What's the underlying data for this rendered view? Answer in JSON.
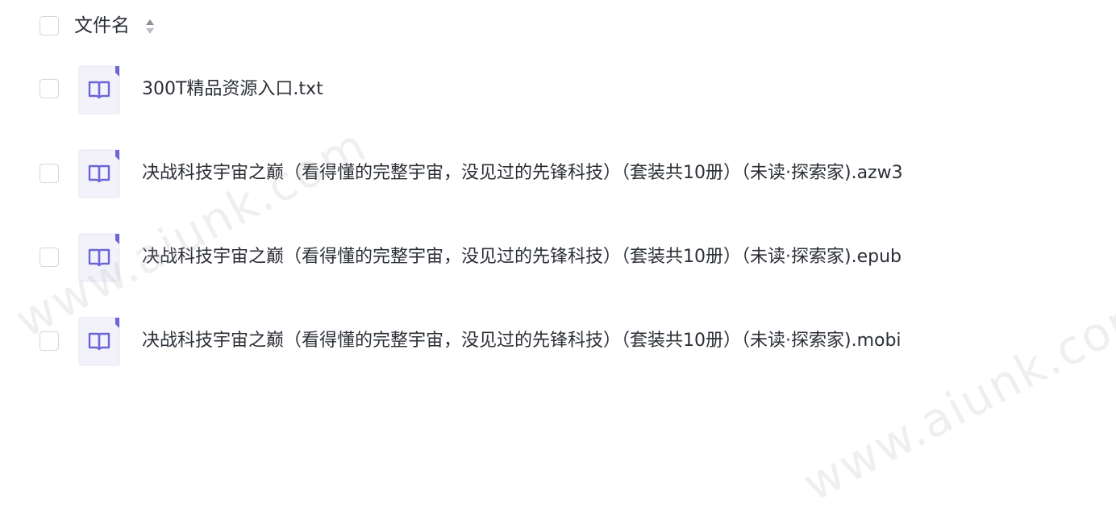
{
  "header": {
    "column_label": "文件名"
  },
  "files": [
    {
      "name": "300T精品资源入口.txt"
    },
    {
      "name": "决战科技宇宙之巅（看得懂的完整宇宙，没见过的先锋科技）（套装共10册）（未读·探索家).azw3"
    },
    {
      "name": "决战科技宇宙之巅（看得懂的完整宇宙，没见过的先锋科技）（套装共10册）（未读·探索家).epub"
    },
    {
      "name": "决战科技宇宙之巅（看得懂的完整宇宙，没见过的先锋科技）（套装共10册）（未读·探索家).mobi"
    }
  ],
  "icons": {
    "file_icon": "book-icon",
    "sort_icon": "sort-icon"
  },
  "watermarks": [
    {
      "text": "www.aiunk.com"
    },
    {
      "text": "www.aiunk.com"
    }
  ],
  "colors": {
    "icon_accent": "#6b66d6",
    "icon_bg": "#f3f2fb",
    "checkbox_border": "#d4d7dd",
    "text": "#2b2f36",
    "sort_up": "#8a8f99",
    "sort_down": "#b9bdc5"
  }
}
